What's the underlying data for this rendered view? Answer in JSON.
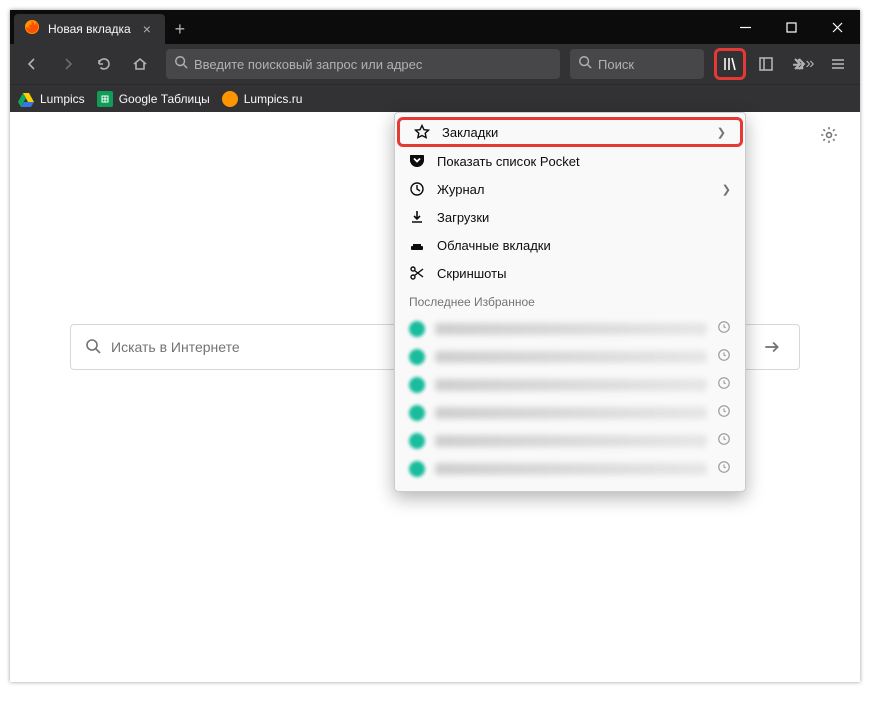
{
  "tab": {
    "title": "Новая вкладка"
  },
  "addressbar": {
    "placeholder": "Введите поисковый запрос или адрес"
  },
  "searchbar": {
    "placeholder": "Поиск"
  },
  "bookmarks": [
    {
      "label": "Lumpics",
      "icon": "gdrive"
    },
    {
      "label": "Google Таблицы",
      "icon": "gsheets"
    },
    {
      "label": "Lumpics.ru",
      "icon": "lumpics"
    }
  ],
  "library_menu": {
    "items": [
      {
        "label": "Закладки",
        "icon": "star",
        "hasSubmenu": true,
        "highlight": true
      },
      {
        "label": "Показать список Pocket",
        "icon": "pocket"
      },
      {
        "label": "Журнал",
        "icon": "history",
        "hasSubmenu": true
      },
      {
        "label": "Загрузки",
        "icon": "download"
      },
      {
        "label": "Облачные вкладки",
        "icon": "cloud"
      },
      {
        "label": "Скриншоты",
        "icon": "scissors"
      }
    ],
    "recent_header": "Последнее Избранное",
    "recent_count": 6
  },
  "page_search": {
    "placeholder": "Искать в Интернете"
  }
}
